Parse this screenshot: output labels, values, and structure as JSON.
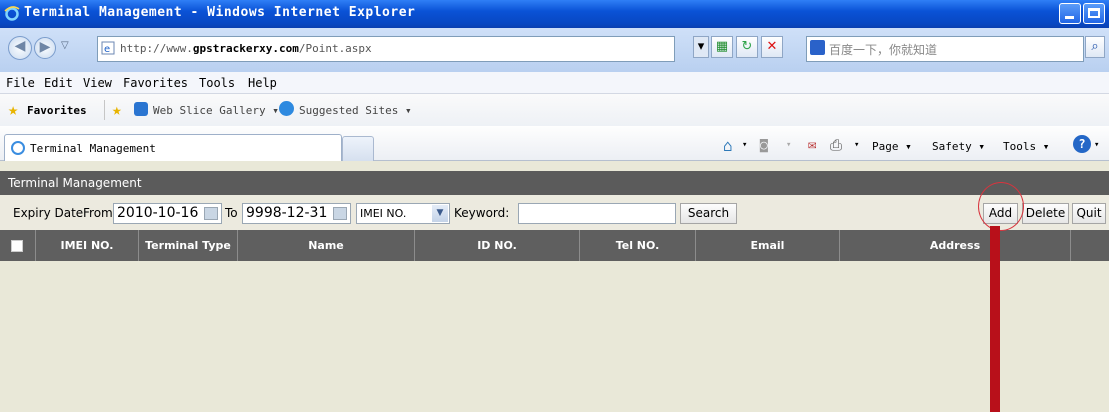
{
  "window": {
    "title": "Terminal Management - Windows Internet Explorer"
  },
  "address": {
    "url_prefix": "http://www.",
    "url_domain": "gpstrackerxy.com",
    "url_path": "/Point.aspx",
    "search_placeholder": "百度一下，你就知道"
  },
  "menu": {
    "items": [
      "File",
      "Edit",
      "View",
      "Favorites",
      "Tools",
      "Help"
    ]
  },
  "favorites": {
    "label": "Favorites",
    "web_slice": "Web Slice Gallery ▾",
    "suggested": "Suggested Sites ▾"
  },
  "tab": {
    "title": "Terminal Management"
  },
  "commands": {
    "page": "Page ▾",
    "safety": "Safety ▾",
    "tools": "Tools ▾"
  },
  "page": {
    "header": "Terminal Management",
    "filter": {
      "expiry_label": "Expiry Date",
      "from_label": "From",
      "from_value": "2010-10-16",
      "to_label": "To",
      "to_value": "9998-12-31",
      "field_select": "IMEI NO.",
      "keyword_label": "Keyword:",
      "keyword_value": "",
      "search_button": "Search",
      "add_button": "Add",
      "delete_button": "Delete",
      "quit_button": "Quit"
    },
    "grid_columns": [
      "IMEI NO.",
      "Terminal Type",
      "Name",
      "ID NO.",
      "Tel NO.",
      "Email",
      "Address"
    ]
  },
  "colors": {
    "title_bar": "#0a52d6",
    "page_header": "#5b5b5b",
    "grid_header": "#5f5f5f",
    "annotation": "#c0101a"
  }
}
